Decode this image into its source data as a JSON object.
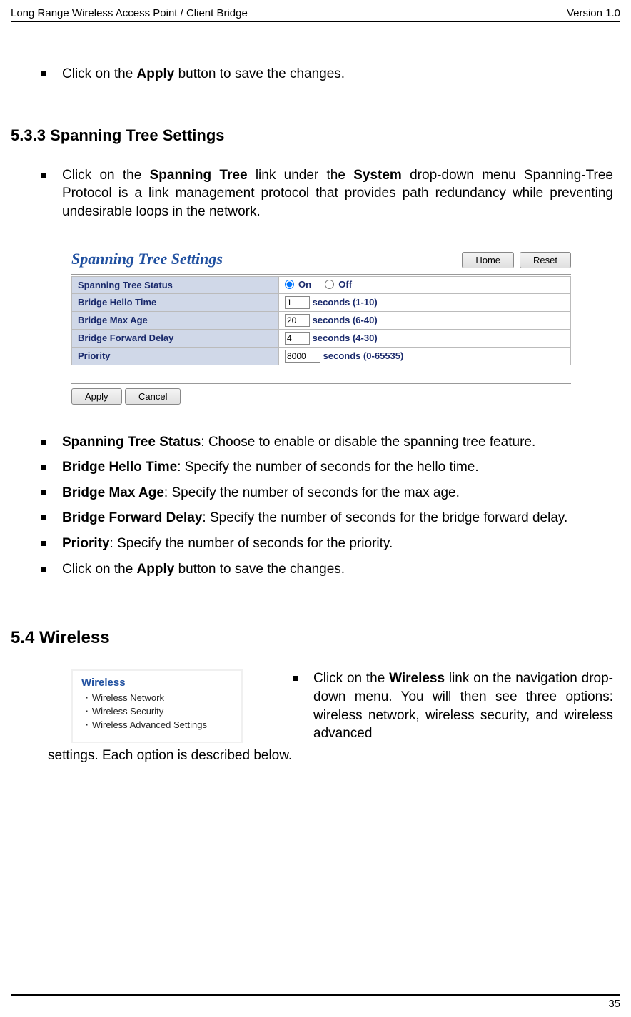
{
  "header": {
    "left": "Long Range Wireless Access Point / Client Bridge",
    "right": "Version 1.0"
  },
  "intro_bullet": {
    "prefix": "Click on the ",
    "bold": "Apply",
    "suffix": " button to save the changes."
  },
  "section_533": {
    "heading": "5.3.3 Spanning Tree Settings",
    "bullet1": {
      "prefix": "Click on the ",
      "bold1": "Spanning Tree",
      "mid": " link under the ",
      "bold2": "System",
      "suffix": " drop-down menu Spanning-Tree Protocol is a link management protocol that provides path redundancy while preventing undesirable loops in the network."
    }
  },
  "settings_panel": {
    "title": "Spanning Tree Settings",
    "home_btn": "Home",
    "reset_btn": "Reset",
    "rows": {
      "status_label": "Spanning Tree Status",
      "on_label": "On",
      "off_label": "Off",
      "hello_label": "Bridge Hello Time",
      "hello_value": "1",
      "hello_suffix": "seconds (1-10)",
      "maxage_label": "Bridge Max Age",
      "maxage_value": "20",
      "maxage_suffix": "seconds (6-40)",
      "forward_label": "Bridge Forward Delay",
      "forward_value": "4",
      "forward_suffix": "seconds (4-30)",
      "priority_label": "Priority",
      "priority_value": "8000",
      "priority_suffix": "seconds (0-65535)"
    },
    "apply_btn": "Apply",
    "cancel_btn": "Cancel"
  },
  "descriptions": {
    "status": {
      "bold": "Spanning Tree Status",
      "text": ": Choose to enable or disable the spanning tree feature."
    },
    "hello": {
      "bold": "Bridge Hello Time",
      "text": ": Specify the number of seconds for the hello time."
    },
    "maxage": {
      "bold": "Bridge Max Age",
      "text": ": Specify the number of seconds for the max age."
    },
    "forward": {
      "bold": "Bridge Forward Delay",
      "text": ": Specify the number of seconds for the bridge forward delay."
    },
    "priority": {
      "bold": "Priority",
      "text": ": Specify the number of seconds for the priority."
    },
    "apply": {
      "prefix": "Click on the ",
      "bold": "Apply",
      "suffix": " button to save the changes."
    }
  },
  "section_54": {
    "heading": "5.4   Wireless",
    "menu": {
      "title": "Wireless",
      "items": [
        "Wireless Network",
        "Wireless Security",
        "Wireless Advanced Settings"
      ]
    },
    "bullet": {
      "prefix": "Click on the ",
      "bold": "Wireless",
      "suffix": " link on the navigation drop-down menu. You will then see three options: wireless network, wireless security, and wireless advanced"
    },
    "continued": "settings. Each option is described below."
  },
  "footer": {
    "page": "35"
  }
}
